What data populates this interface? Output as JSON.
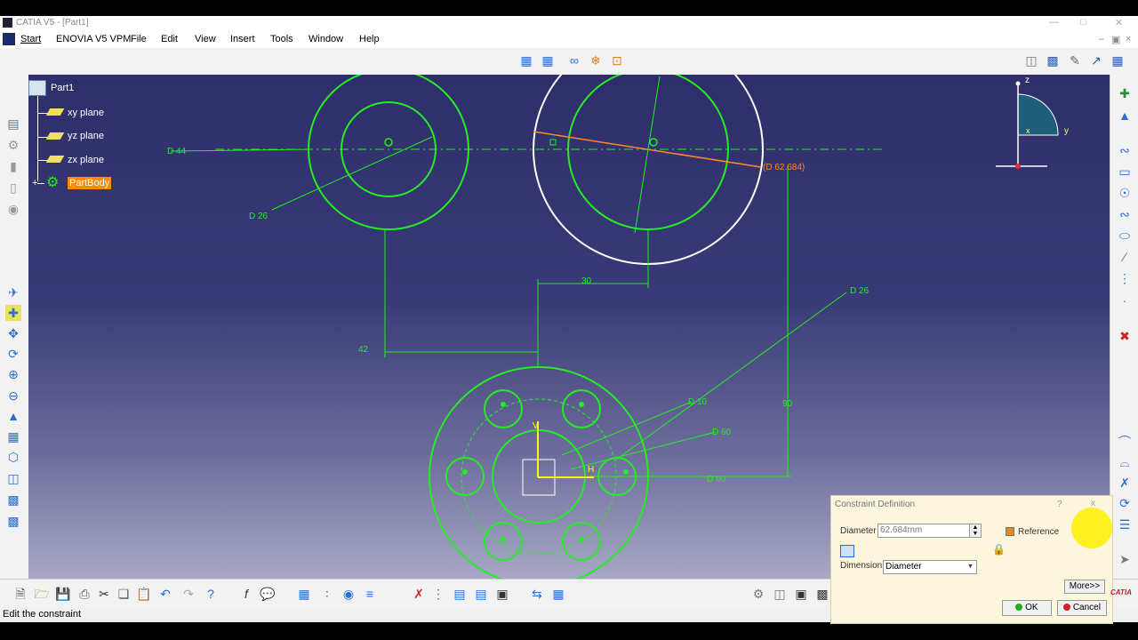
{
  "window": {
    "title": "CATIA V5 - [Part1]"
  },
  "menu": {
    "start": "Start",
    "enovia": "ENOVIA V5 VPM",
    "file": "File",
    "edit": "Edit",
    "view": "View",
    "insert": "Insert",
    "tools": "Tools",
    "window": "Window",
    "help": "Help"
  },
  "tree": {
    "root": "Part1",
    "items": [
      {
        "label": "xy plane"
      },
      {
        "label": "yz plane"
      },
      {
        "label": "zx plane"
      },
      {
        "label": "PartBody"
      }
    ]
  },
  "sketch": {
    "labels": {
      "d44": "D 44",
      "d26_left": "D 26",
      "d62": "(D 62.684)",
      "dim30": "30",
      "d26_right": "D 26",
      "dim42": "42",
      "dim90": "90",
      "d10": "D 10",
      "d60": "D 60",
      "d_lower": "D 60",
      "axis_v": "V",
      "axis_h": "H"
    },
    "colors": {
      "geometry": "#22ee22",
      "selected": "#ff8a2a",
      "construction": "#ffffff",
      "axis": "#ffff00"
    }
  },
  "compass": {
    "z": "z",
    "y": "y",
    "x": "x"
  },
  "dialog": {
    "title": "Constraint Definition",
    "help": "?",
    "close": "x",
    "diameter_label": "Diameter",
    "diameter_value": "62.684mm",
    "reference_label": "Reference",
    "dimension_label": "Dimension",
    "dimension_value": "Diameter",
    "more_label": "More>>",
    "ok_label": "OK",
    "cancel_label": "Cancel"
  },
  "status": {
    "text": "Edit the constraint"
  },
  "brand": {
    "logo_text": "CATIA"
  }
}
